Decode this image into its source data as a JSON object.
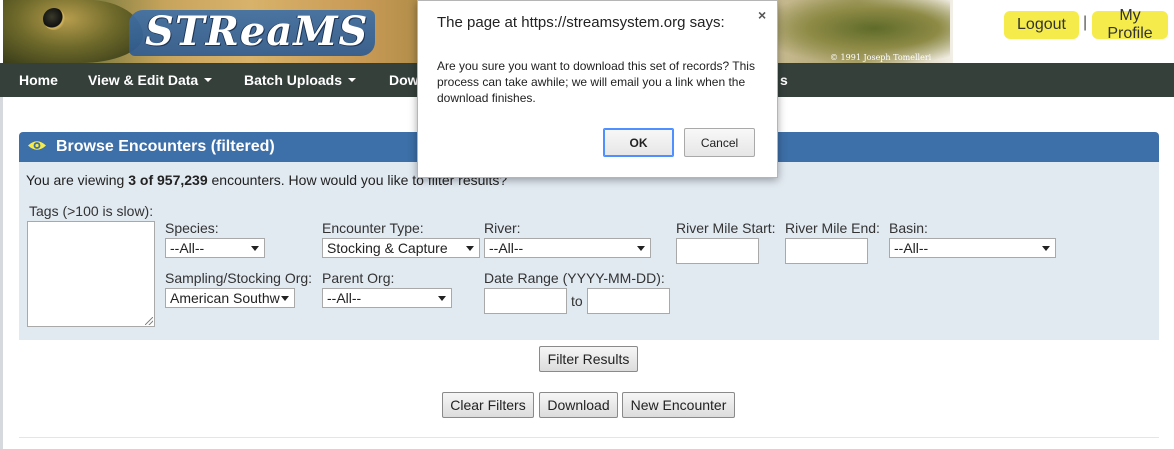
{
  "banner": {
    "logo": "STReaMS",
    "copyright": "© 1991 Joseph Tomelleri",
    "logout_label": "Logout",
    "separator": "|",
    "profile_label": "My Profile"
  },
  "nav": {
    "items": [
      {
        "label": "Home"
      },
      {
        "label": "View & Edit Data"
      },
      {
        "label": "Batch Uploads"
      },
      {
        "label": "Dow"
      },
      {
        "label": "s"
      }
    ]
  },
  "panel": {
    "title": "Browse Encounters (filtered)",
    "viewing_prefix": "You are viewing ",
    "viewing_count": "3 of 957,239",
    "viewing_suffix": " encounters. How would you like to filter results?"
  },
  "filters": {
    "tags_label": "Tags (>100 is slow):",
    "species_label": "Species:",
    "species_value": "--All--",
    "encounter_type_label": "Encounter Type:",
    "encounter_type_value": "Stocking & Capture",
    "river_label": "River:",
    "river_value": "--All--",
    "river_mile_start_label": "River Mile Start:",
    "river_mile_end_label": "River Mile End:",
    "basin_label": "Basin:",
    "basin_value": "--All--",
    "sampling_org_label": "Sampling/Stocking Org:",
    "sampling_org_value": "American Southw",
    "parent_org_label": "Parent Org:",
    "parent_org_value": "--All--",
    "date_range_label": "Date Range (YYYY-MM-DD):",
    "date_to": "to"
  },
  "buttons": {
    "filter_results": "Filter Results",
    "clear_filters": "Clear Filters",
    "download": "Download",
    "new_encounter": "New Encounter"
  },
  "dialog": {
    "title": "The page at https://streamsystem.org says:",
    "close": "×",
    "message": "Are you sure you want to download this set of records? This process can take awhile; we will email you a link when the download finishes.",
    "ok_label": "OK",
    "cancel_label": "Cancel"
  },
  "colors": {
    "navbar": "#35403b",
    "panel_header": "#3d6fa8",
    "panel_body": "#e1e9f1",
    "yellow_button": "#f5ec4b"
  }
}
